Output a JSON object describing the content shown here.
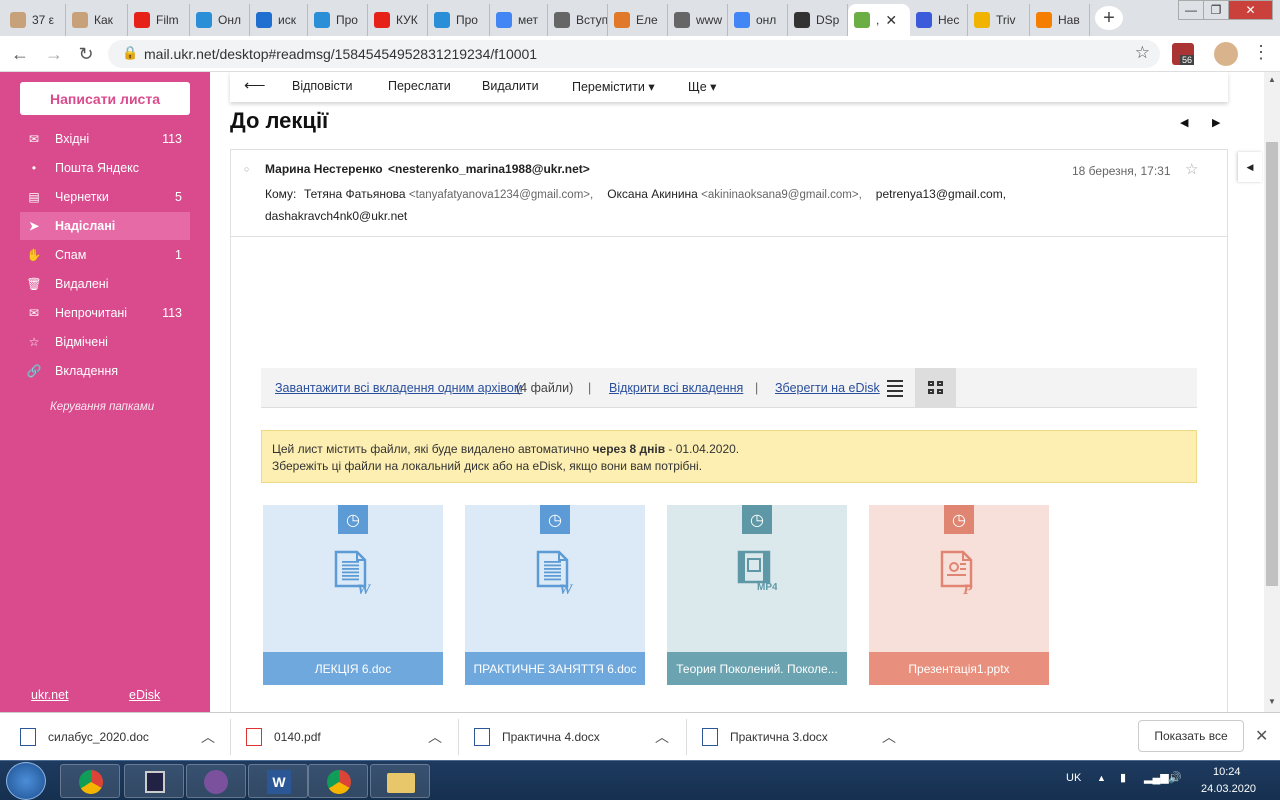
{
  "browser": {
    "tabs": [
      {
        "title": "37 ε",
        "color": "#c7a17a"
      },
      {
        "title": "Как",
        "color": "#c7a17a"
      },
      {
        "title": "Film",
        "color": "#e62117"
      },
      {
        "title": "Онл",
        "color": "#2a8fd6"
      },
      {
        "title": "иск",
        "color": "#1f6fd1"
      },
      {
        "title": "Про",
        "color": "#2a8fd6"
      },
      {
        "title": "КУК",
        "color": "#e62117"
      },
      {
        "title": "Про",
        "color": "#2a8fd6"
      },
      {
        "title": "мет",
        "color": "#4285f4"
      },
      {
        "title": "Вступ",
        "color": "#666666"
      },
      {
        "title": "Еле",
        "color": "#e07a2a"
      },
      {
        "title": "www",
        "color": "#666666"
      },
      {
        "title": "онл",
        "color": "#4285f4"
      },
      {
        "title": "DSp",
        "color": "#333333"
      },
      {
        "title": ",",
        "color": "#6cae46"
      },
      {
        "title": "Нес",
        "color": "#3b5bdb"
      },
      {
        "title": "Triv",
        "color": "#f0b400"
      },
      {
        "title": "Нав",
        "color": "#f57d00"
      }
    ],
    "url": "mail.ukr.net/desktop#readmsg/15845454952831219234/f10001",
    "ext_badge": "56"
  },
  "sidebar": {
    "compose": "Написати листа",
    "items": [
      {
        "label": "Вхідні",
        "count": "113",
        "icon": "inbox-icon",
        "glyph": "✉"
      },
      {
        "label": "Пошта Яндекс",
        "count": "",
        "icon": "dot-icon",
        "glyph": "•"
      },
      {
        "label": "Чернетки",
        "count": "5",
        "icon": "draft-icon",
        "glyph": "▤"
      },
      {
        "label": "Надіслані",
        "count": "",
        "icon": "sent-icon",
        "glyph": "➤"
      },
      {
        "label": "Спам",
        "count": "1",
        "icon": "spam-icon",
        "glyph": "✋"
      },
      {
        "label": "Видалені",
        "count": "",
        "icon": "trash-icon",
        "glyph": "🗑"
      },
      {
        "label": "Непрочитані",
        "count": "113",
        "icon": "unread-icon",
        "glyph": "✉"
      },
      {
        "label": "Відмічені",
        "count": "",
        "icon": "star-icon",
        "glyph": "☆"
      },
      {
        "label": "Вкладення",
        "count": "",
        "icon": "paperclip-icon",
        "glyph": "🔗"
      }
    ],
    "manage": "Керування папками",
    "footer_left": "ukr.net",
    "footer_right": "eDisk"
  },
  "toolbar": {
    "back": "⟵",
    "reply": "Відповісти",
    "forward": "Переслати",
    "delete": "Видалити",
    "move": "Перемістити ▾",
    "more": "Ще ▾"
  },
  "message": {
    "subject": "До лекції",
    "sender_name": "Марина Нестеренко",
    "sender_email": "<nesterenko_marina1988@ukr.net>",
    "date": "18 березня, 17:31",
    "to_label": "Кому:",
    "recipients_line1": [
      {
        "name": "Тетяна Фатьянова",
        "email": "<tanyafatyanova1234@gmail.com>,"
      },
      {
        "name": "Оксана Акинина",
        "email": "<akininaoksana9@gmail.com>,"
      },
      {
        "name": "petrenya13@gmail.com,",
        "email": ""
      }
    ],
    "recipients_line2": "dashakravch4nk0@ukr.net"
  },
  "attachments": {
    "download_all": "Завантажити всі вкладення одним архівом",
    "count_text": "(4 файли)",
    "open_all": "Відкрити всі вкладення",
    "save_edisk": "Зберегти на eDisk",
    "sep": "|",
    "warn_line1_a": "Цей лист містить файли, які буде видалено автоматично ",
    "warn_line1_b": "через 8 днів",
    "warn_line1_c": " - 01.04.2020.",
    "warn_line2": "Збережіть ці файли на локальний диск або на eDisk, якщо вони вам потрібні.",
    "files": [
      {
        "name": "ЛЕКЦІЯ 6.doc",
        "type": "word",
        "ext": "W",
        "bg": "#dceaf7",
        "bar": "#6fa8dc",
        "accent": "#5c9bd6"
      },
      {
        "name": "ПРАКТИЧНЕ ЗАНЯТТЯ 6.doc",
        "type": "word",
        "ext": "W",
        "bg": "#dceaf7",
        "bar": "#6fa8dc",
        "accent": "#5c9bd6"
      },
      {
        "name": "Теория Поколений. Поколе...",
        "type": "video",
        "ext": "MP4",
        "bg": "#dbe9ec",
        "bar": "#6ba3b0",
        "accent": "#5e98a6"
      },
      {
        "name": "Презентація1.pptx",
        "type": "ppt",
        "ext": "P",
        "bg": "#f8e0da",
        "bar": "#e8907d",
        "accent": "#e08571"
      }
    ]
  },
  "downloads": {
    "items": [
      {
        "name": "силабус_2020.doc",
        "icon": "word-file-icon"
      },
      {
        "name": "0140.pdf",
        "icon": "pdf-file-icon"
      },
      {
        "name": "Практична 4.docx",
        "icon": "word-file-icon"
      },
      {
        "name": "Практична 3.docx",
        "icon": "word-file-icon"
      }
    ],
    "show_all": "Показать все"
  },
  "taskbar": {
    "lang": "UK",
    "time": "10:24",
    "date": "24.03.2020"
  }
}
